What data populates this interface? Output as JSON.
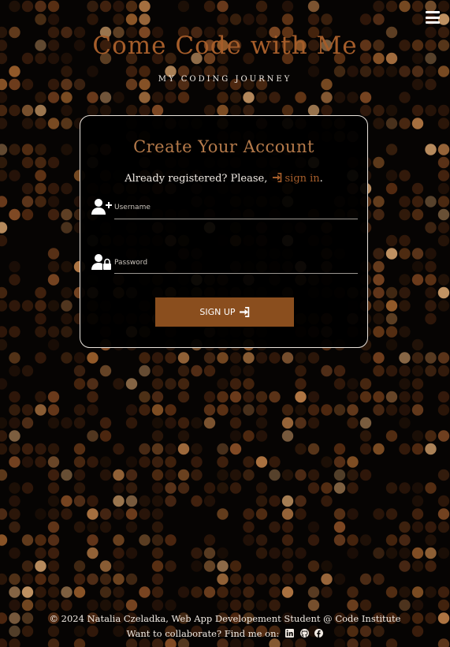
{
  "header": {
    "menu_icon": "bars-icon",
    "title": "Come Code with Me",
    "subtitle": "MY CODING JOURNEY"
  },
  "signup_form": {
    "heading": "Create Your Account",
    "already_text": "Already registered? Please,",
    "signin_link": "sign in",
    "signin_icon": "sign-in-icon",
    "trailing_period": ".",
    "username": {
      "icon": "user-plus-icon",
      "placeholder": "Username",
      "value": ""
    },
    "password": {
      "icon": "user-lock-icon",
      "placeholder": "Password",
      "value": ""
    },
    "submit_label": "SIGN UP",
    "submit_icon": "sign-in-icon"
  },
  "footer": {
    "copyright": "© 2024 Natalia Czeladka, Web App Developement Student @ Code Institute",
    "collaborate_text": "Want to collaborate? Find me on:",
    "social_icons": [
      "linkedin-icon",
      "github-icon",
      "facebook-icon"
    ]
  },
  "colors": {
    "background": "#060403",
    "accent": "#a55d2a",
    "button": "#8a4e1e",
    "text": "#f1ebe4"
  }
}
